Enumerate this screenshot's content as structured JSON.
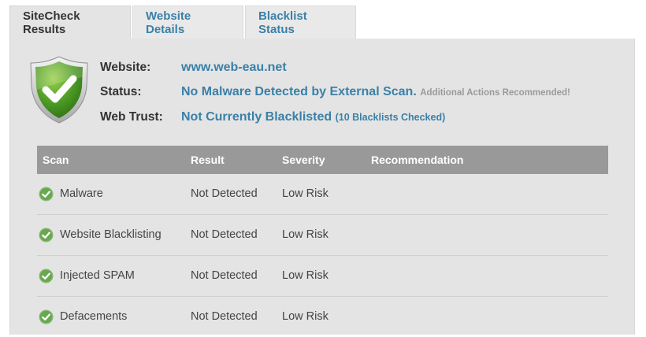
{
  "tabs": [
    {
      "label": "SiteCheck Results",
      "active": true
    },
    {
      "label": "Website Details",
      "active": false
    },
    {
      "label": "Blacklist Status",
      "active": false
    }
  ],
  "summary": {
    "shield_icon": "green-shield-checkmark-icon",
    "website_label": "Website:",
    "website_value": "www.web-eau.net",
    "status_label": "Status:",
    "status_value": "No Malware Detected by External Scan.",
    "status_note": "Additional Actions Recommended!",
    "trust_label": "Web Trust:",
    "trust_value": "Not Currently Blacklisted",
    "trust_note": "(10 Blacklists Checked)"
  },
  "table": {
    "headers": [
      "Scan",
      "Result",
      "Severity",
      "Recommendation"
    ],
    "rows": [
      {
        "scan": "Malware",
        "result": "Not Detected",
        "severity": "Low Risk",
        "recommendation": ""
      },
      {
        "scan": "Website Blacklisting",
        "result": "Not Detected",
        "severity": "Low Risk",
        "recommendation": ""
      },
      {
        "scan": "Injected SPAM",
        "result": "Not Detected",
        "severity": "Low Risk",
        "recommendation": ""
      },
      {
        "scan": "Defacements",
        "result": "Not Detected",
        "severity": "Low Risk",
        "recommendation": ""
      }
    ]
  },
  "colors": {
    "link_blue": "#3a80a8",
    "header_gray": "#999999",
    "panel_gray": "#e4e4e4",
    "check_green": "#6aa84f"
  }
}
